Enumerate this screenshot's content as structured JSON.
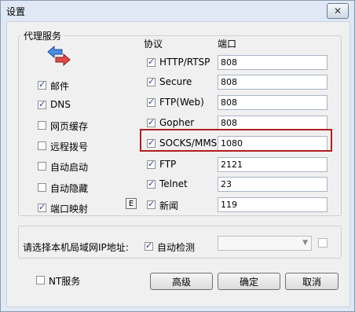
{
  "window": {
    "title": "设置",
    "close_glyph": "✕"
  },
  "proxy": {
    "group_label": "代理服务",
    "icon": "network-arrows-icon",
    "col_protocol": "协议",
    "col_port": "端口",
    "left_options": [
      {
        "label": "邮件",
        "checked": true
      },
      {
        "label": "DNS",
        "checked": true
      },
      {
        "label": "网页缓存",
        "checked": false
      },
      {
        "label": "远程拨号",
        "checked": false
      },
      {
        "label": "自动启动",
        "checked": false
      },
      {
        "label": "自动隐藏",
        "checked": false
      },
      {
        "label": "端口映射",
        "checked": true
      }
    ],
    "edit_button": "E",
    "protocols": [
      {
        "name": "HTTP/RTSP",
        "checked": true,
        "port": "808"
      },
      {
        "name": "Secure",
        "checked": true,
        "port": "808"
      },
      {
        "name": "FTP(Web)",
        "checked": true,
        "port": "808"
      },
      {
        "name": "Gopher",
        "checked": true,
        "port": "808"
      },
      {
        "name": "SOCKS/MMS",
        "checked": true,
        "port": "1080"
      },
      {
        "name": "FTP",
        "checked": true,
        "port": "2121"
      },
      {
        "name": "Telnet",
        "checked": true,
        "port": "23"
      },
      {
        "name": "新闻",
        "checked": true,
        "port": "119"
      }
    ]
  },
  "lan": {
    "label": "请选择本机局域网IP地址:",
    "auto_detect_label": "自动检测",
    "auto_detect_checked": true,
    "ip_value": ""
  },
  "footer": {
    "nt_service_label": "NT服务",
    "nt_service_checked": false,
    "advanced": "高级",
    "ok": "确定",
    "cancel": "取消"
  },
  "colors": {
    "highlight": "#b01f1f",
    "check": "#243b9e"
  }
}
